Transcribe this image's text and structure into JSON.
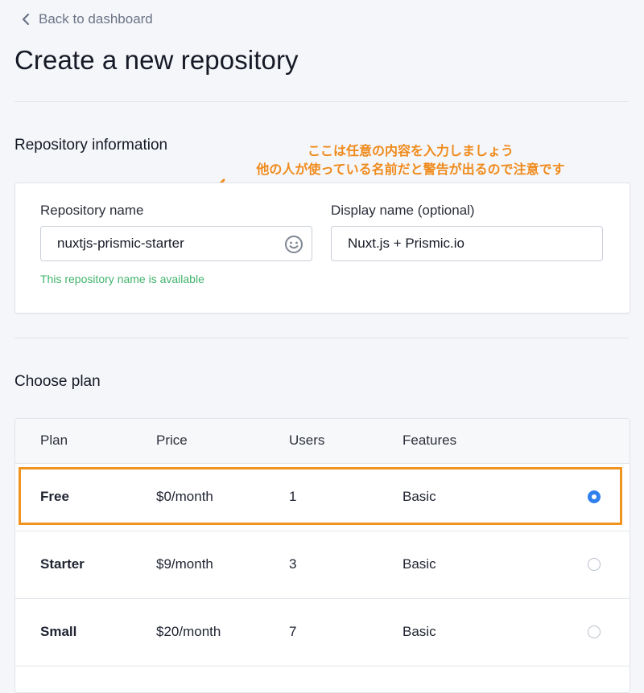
{
  "nav": {
    "back_label": "Back to dashboard"
  },
  "page_title": "Create a new repository",
  "repo_info": {
    "section_title": "Repository information",
    "repo_name": {
      "label": "Repository name",
      "value": "nuxtjs-prismic-starter",
      "hint": "This repository name is available",
      "icon": "smiley-icon"
    },
    "display_name": {
      "label": "Display name (optional)",
      "value": "Nuxt.js + Prismic.io"
    }
  },
  "annotation": {
    "line1": "ここは任意の内容を入力しましょう",
    "line2": "他の人が使っている名前だと警告が出るので注意です",
    "color": "#ef8a1b"
  },
  "plans": {
    "section_title": "Choose plan",
    "columns": [
      "Plan",
      "Price",
      "Users",
      "Features"
    ],
    "rows": [
      {
        "plan": "Free",
        "price": "$0/month",
        "users": "1",
        "features": "Basic",
        "selected": true
      },
      {
        "plan": "Starter",
        "price": "$9/month",
        "users": "3",
        "features": "Basic",
        "selected": false
      },
      {
        "plan": "Small",
        "price": "$20/month",
        "users": "7",
        "features": "Basic",
        "selected": false
      }
    ],
    "selected_color": "#2f80ed",
    "highlight_color": "#f0941f"
  }
}
